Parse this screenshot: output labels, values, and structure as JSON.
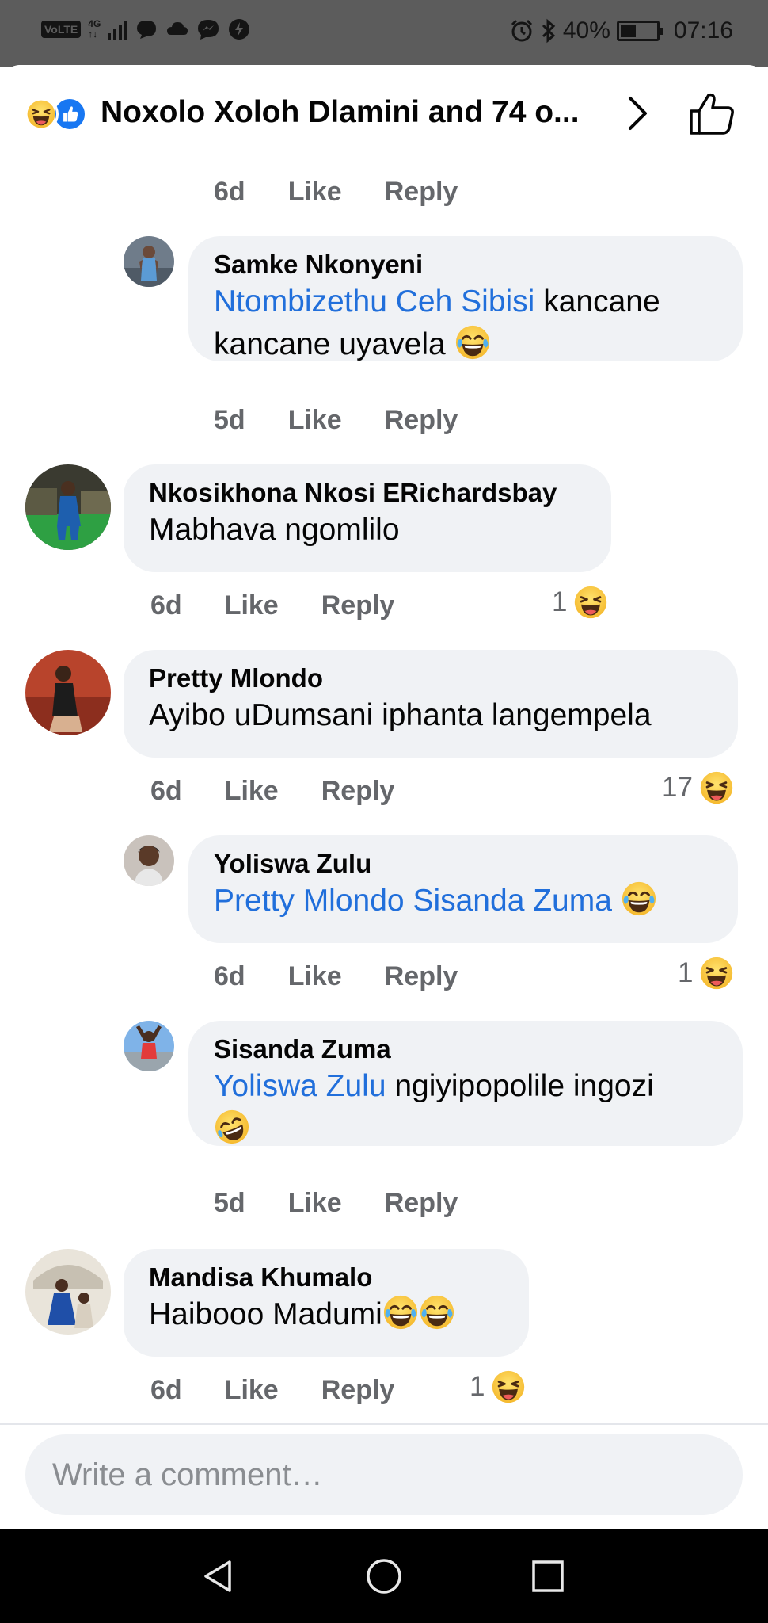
{
  "status_bar": {
    "volte": "VoLTE",
    "network": "4G",
    "battery": "40%",
    "time": "07:16",
    "icons": [
      "signal-icon",
      "chat-icon",
      "cloud-icon",
      "messenger-icon",
      "power-icon",
      "alarm-icon",
      "bluetooth-icon",
      "battery-icon"
    ]
  },
  "header": {
    "title": "Noxolo Xoloh Dlamini and 74 o...",
    "reaction_icons": [
      "haha-icon",
      "like-icon"
    ]
  },
  "comments": [
    {
      "meta": {
        "time": "6d",
        "like": "Like",
        "reply": "Reply"
      }
    },
    {
      "author": "Samke Nkonyeni",
      "mention": "Ntombizethu Ceh Sibisi",
      "text_line1": " kancane",
      "text_line2": "kancane uyavela",
      "meta": {
        "time": "5d",
        "like": "Like",
        "reply": "Reply"
      }
    },
    {
      "author": "Nkosikhona Nkosi ERichardsbay",
      "text": "Mabhava ngomlilo",
      "meta": {
        "time": "6d",
        "like": "Like",
        "reply": "Reply"
      },
      "reaction_count": "1"
    },
    {
      "author": "Pretty Mlondo",
      "text": "Ayibo uDumsani iphanta langempela",
      "meta": {
        "time": "6d",
        "like": "Like",
        "reply": "Reply"
      },
      "reaction_count": "17"
    },
    {
      "author": "Yoliswa Zulu",
      "mention": "Pretty Mlondo Sisanda Zuma",
      "meta": {
        "time": "6d",
        "like": "Like",
        "reply": "Reply"
      },
      "reaction_count": "1"
    },
    {
      "author": "Sisanda Zuma",
      "mention": "Yoliswa Zulu",
      "text_line1": " ngiyipopolile ingozi",
      "meta": {
        "time": "5d",
        "like": "Like",
        "reply": "Reply"
      }
    },
    {
      "author": "Mandisa Khumalo",
      "text": "Haibooo Madumi",
      "meta": {
        "time": "6d",
        "like": "Like",
        "reply": "Reply"
      },
      "reaction_count": "1"
    }
  ],
  "composer": {
    "placeholder": "Write a comment…"
  },
  "colors": {
    "mention": "#216fdb",
    "bubble": "#f0f2f5",
    "meta": "#65676b",
    "like_blue": "#1877f2",
    "emoji_yellow": "#f7c733"
  }
}
